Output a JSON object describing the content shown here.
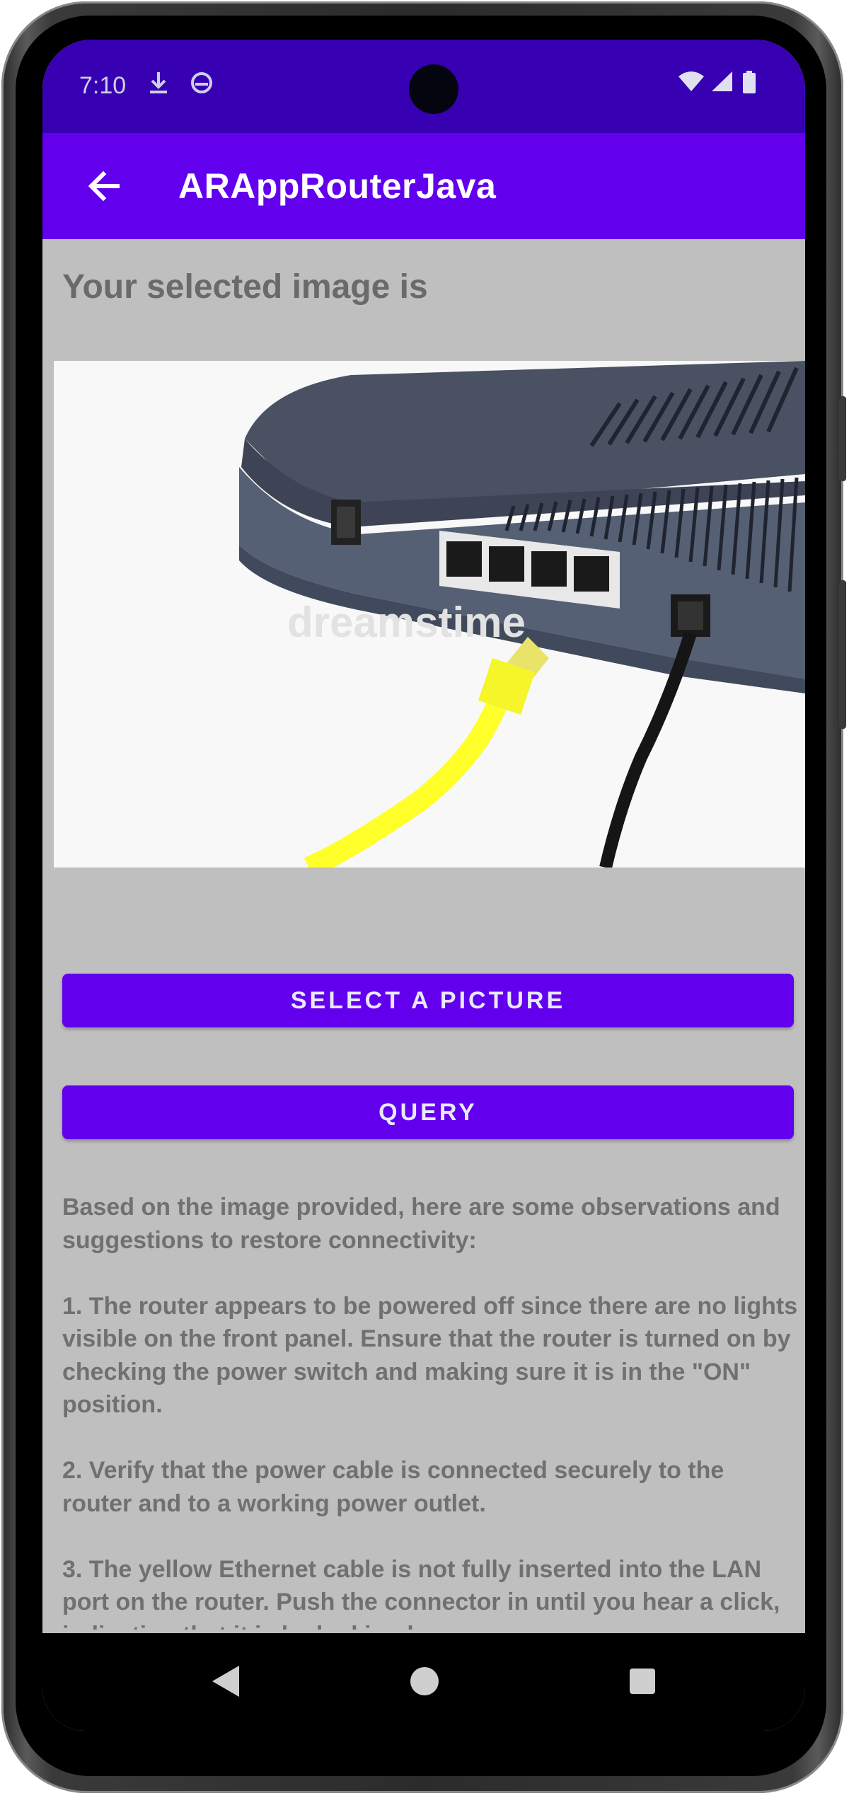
{
  "status_bar": {
    "time": "7:10",
    "icons": [
      "download-icon",
      "data-saver-icon",
      "wifi-icon",
      "signal-icon",
      "battery-icon"
    ]
  },
  "app_bar": {
    "title": "ARAppRouterJava",
    "back_icon": "arrow-back-icon"
  },
  "main": {
    "heading": "Your selected image is",
    "image_watermark": "dreamstime",
    "select_button_label": "SELECT A PICTURE",
    "query_button_label": "QUERY",
    "response_paragraphs": [
      "Based on the image provided, here are some observations and suggestions to restore connectivity:",
      "1. The router appears to be powered off since there are no lights visible on the front panel. Ensure that the router is turned on by checking the power switch and making sure it is in the \"ON\" position.",
      "2. Verify that the power cable is connected securely to the router and to a working power outlet.",
      "3. The yellow Ethernet cable is not fully inserted into the LAN port on the router. Push the connector in until you hear a click, indicating that it is locked in place."
    ]
  },
  "nav_bar": {
    "icons": [
      "nav-back-icon",
      "nav-home-icon",
      "nav-recents-icon"
    ]
  },
  "colors": {
    "status_bar": "#3700b3",
    "app_bar": "#6200ee",
    "button": "#6200ee",
    "overlay_background": "#bfbfbf"
  }
}
